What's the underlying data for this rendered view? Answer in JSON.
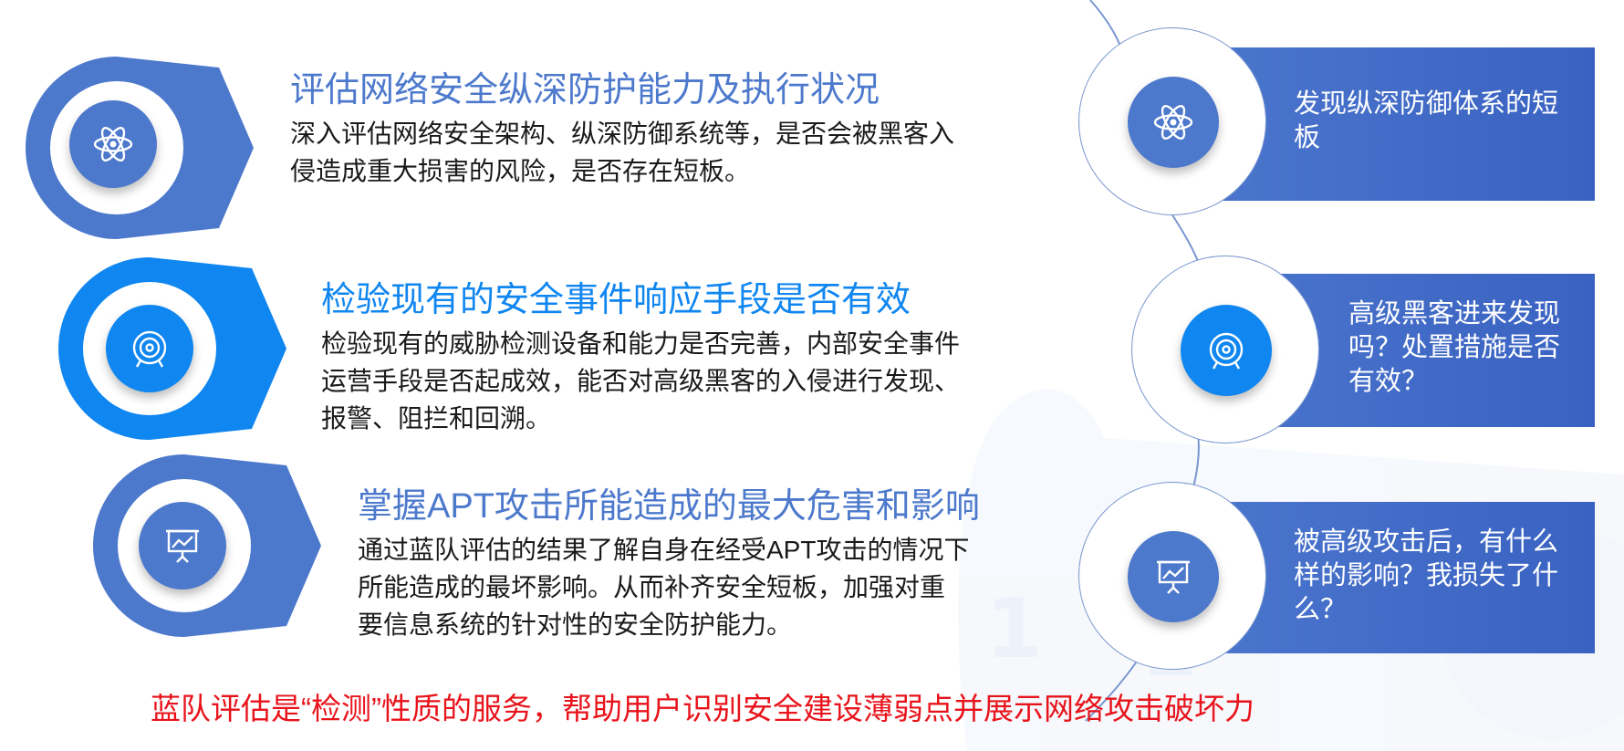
{
  "colors": {
    "dark_blue": "#4d79cc",
    "bright_blue": "#0f86f0",
    "footer_red": "#e8131b",
    "panel_blue": "#3f68c6"
  },
  "items": [
    {
      "icon": "atom-icon",
      "title": "评估网络安全纵深防护能力及执行状况",
      "desc_lines": [
        "深入评估网络安全架构、纵深防御系统等，是否会被黑客入",
        "侵造成重大损害的风险，是否存在短板。"
      ]
    },
    {
      "icon": "target-icon",
      "title": "检验现有的安全事件响应手段是否有效",
      "desc_lines": [
        "检验现有的威胁检测设备和能力是否完善，内部安全事件",
        "运营手段是否起成效，能否对高级黑客的入侵进行发现、",
        "报警、阻拦和回溯。"
      ]
    },
    {
      "icon": "presentation-icon",
      "title": "掌握APT攻击所能造成的最大危害和影响",
      "desc_lines": [
        "通过蓝队评估的结果了解自身在经受APT攻击的情况下",
        "所能造成的最坏影响。从而补齐安全短板，加强对重",
        "要信息系统的针对性的安全防护能力。"
      ]
    }
  ],
  "panels": [
    {
      "icon": "atom-icon",
      "lines": [
        "发现纵深防御体系的短",
        "板"
      ]
    },
    {
      "icon": "target-icon",
      "lines": [
        "高级黑客进来发现",
        "吗？处置措施是否",
        "有效？"
      ]
    },
    {
      "icon": "presentation-icon",
      "lines": [
        "被高级攻击后，有什么",
        "样的影响？我损失了什",
        "么？"
      ]
    }
  ],
  "footer": "蓝队评估是“检测”性质的服务，帮助用户识别安全建设薄弱点并展示网络攻击破坏力"
}
